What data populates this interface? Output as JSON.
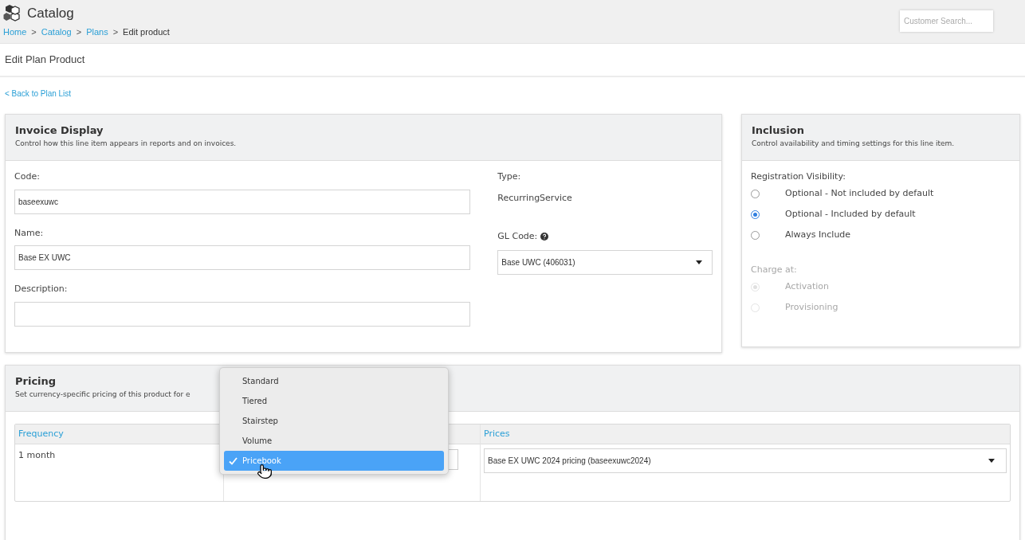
{
  "header": {
    "title": "Catalog",
    "breadcrumbs": [
      {
        "label": "Home",
        "link": true
      },
      {
        "label": "Catalog",
        "link": true
      },
      {
        "label": "Plans",
        "link": true
      },
      {
        "label": "Edit product",
        "link": false
      }
    ],
    "separator": ">",
    "search": {
      "placeholder": "Customer Search..."
    }
  },
  "page_title": "Edit Plan Product",
  "back_link": "< Back to Plan List",
  "invoice_display": {
    "title": "Invoice Display",
    "subtitle": "Control how this line item appears in reports and on invoices.",
    "fields": [
      {
        "label": "Code:",
        "value": "baseexuwc"
      },
      {
        "label": "Name:",
        "value": "Base EX UWC"
      },
      {
        "label": "Description:"
      }
    ],
    "type": {
      "label": "Type:",
      "value": "RecurringService"
    },
    "gl_code": {
      "label": "GL Code:",
      "value": "Base UWC (406031)"
    }
  },
  "inclusion": {
    "title": "Inclusion",
    "subtitle": "Control availability and timing settings for this line item.",
    "groups": [
      {
        "label": "Registration Visibility:",
        "disabled": false,
        "options": [
          {
            "label": "Optional - Not included by default",
            "selected": false
          },
          {
            "label": "Optional - Included by default",
            "selected": true
          },
          {
            "label": "Always Include",
            "selected": false
          }
        ]
      },
      {
        "label": "Charge at:",
        "disabled": true,
        "options": [
          {
            "label": "Activation",
            "selected": true
          },
          {
            "label": "Provisioning",
            "selected": false
          }
        ]
      }
    ]
  },
  "pricing": {
    "title": "Pricing",
    "subtitle": "Set currency-specific pricing of this product for e",
    "columns": [
      {
        "label": "Frequency"
      },
      {
        "label": "Prices"
      }
    ],
    "rows": [
      {
        "frequency": "1 month",
        "price": "Base EX UWC 2024 pricing (baseexuwc2024)"
      }
    ],
    "dropdown": {
      "options": [
        {
          "label": "Standard",
          "selected": false
        },
        {
          "label": "Tiered",
          "selected": false
        },
        {
          "label": "Stairstep",
          "selected": false
        },
        {
          "label": "Volume",
          "selected": false
        },
        {
          "label": "Pricebook",
          "selected": true
        }
      ]
    }
  }
}
